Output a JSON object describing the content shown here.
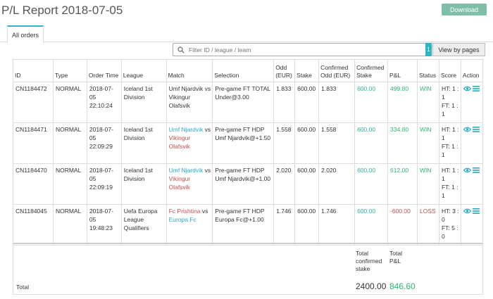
{
  "page": {
    "title": "P/L Report 2018-07-05"
  },
  "toolbar": {
    "download_label": "Download",
    "view_label": "View by pages",
    "page_badge": "1"
  },
  "tabs": [
    {
      "label": "All orders"
    }
  ],
  "search": {
    "placeholder": "Filter ID / league / team",
    "value": ""
  },
  "table": {
    "headers": {
      "id": "ID",
      "type": "Type",
      "order_time": "Order Time",
      "league": "League",
      "match": "Match",
      "selection": "Selection",
      "odd": "Odd (EUR)",
      "stake": "Stake",
      "confirmed_odd": "Confirmed Odd (EUR)",
      "confirmed_stake": "Confirmed Stake",
      "pl": "P&L",
      "status": "Status",
      "score": "Score",
      "action": "Action"
    },
    "rows": [
      {
        "id": "CN1184472",
        "type": "NORMAL",
        "date": "2018-07-05",
        "time": "22:10:24",
        "league": "Iceland 1st Division",
        "home": "Umf Njardvik",
        "vs": "vs",
        "away": "Vikingur Olafsvik",
        "selection": "Pre-game FT TOTAL Under@3.00",
        "odd": "1.833",
        "stake": "600.00",
        "confirmed_odd": "1.833",
        "confirmed_stake": "600.00",
        "pl": "499.80",
        "status": "WIN",
        "ht": "HT: 1 : 1",
        "ft": "FT: 1 : 1"
      },
      {
        "id": "CN1184471",
        "type": "NORMAL",
        "date": "2018-07-05",
        "time": "22:09:29",
        "league": "Iceland 1st Division",
        "home": "Umf Njardvik",
        "vs": "vs",
        "away": "Vikingur Olafsvik",
        "selection": "Pre-game FT HDP Umf Njardvik@+1.50",
        "odd": "1.558",
        "stake": "600.00",
        "confirmed_odd": "1.558",
        "confirmed_stake": "600.00",
        "pl": "334.80",
        "status": "WIN",
        "ht": "HT: 1 : 1",
        "ft": "FT: 1 : 1"
      },
      {
        "id": "CN1184470",
        "type": "NORMAL",
        "date": "2018-07-05",
        "time": "22:09:19",
        "league": "Iceland 1st Division",
        "home": "Umf Njardvik",
        "vs": "vs",
        "away": "Vikingur Olafsvik",
        "selection": "Pre-game FT HDP Umf Njardvik@+1.00",
        "odd": "2.020",
        "stake": "600.00",
        "confirmed_odd": "2.020",
        "confirmed_stake": "600.00",
        "pl": "612.00",
        "status": "WIN",
        "ht": "HT: 1 : 1",
        "ft": "FT: 1 : 1"
      },
      {
        "id": "CN1184045",
        "type": "NORMAL",
        "date": "2018-07-05",
        "time": "19:48:23",
        "league": "Uefa Europa League Qualifiers",
        "home": "Fc Prishtina",
        "vs": "vs",
        "away": "Europa Fc",
        "selection": "Pre-game FT HDP Europa Fc@+1.00",
        "odd": "1.746",
        "stake": "600.00",
        "confirmed_odd": "1.746",
        "confirmed_stake": "600.00",
        "pl": "-600.00",
        "status": "LOSS",
        "ht": "HT: 3 : 0",
        "ft": "FT: 5 : 0"
      }
    ]
  },
  "summary": {
    "total_label": "Total",
    "confirmed_stake_label": "Total confirmed stake",
    "pl_label": "Total P&L",
    "confirmed_stake": "2400.00",
    "pl": "846.60"
  },
  "colors": {
    "accent": "#2bb5c9",
    "win": "#2bb573",
    "loss": "#c0504d",
    "download": "#7fbfa8"
  },
  "icons": {
    "view": "eye-icon",
    "details": "list-icon",
    "search": "search-icon"
  }
}
